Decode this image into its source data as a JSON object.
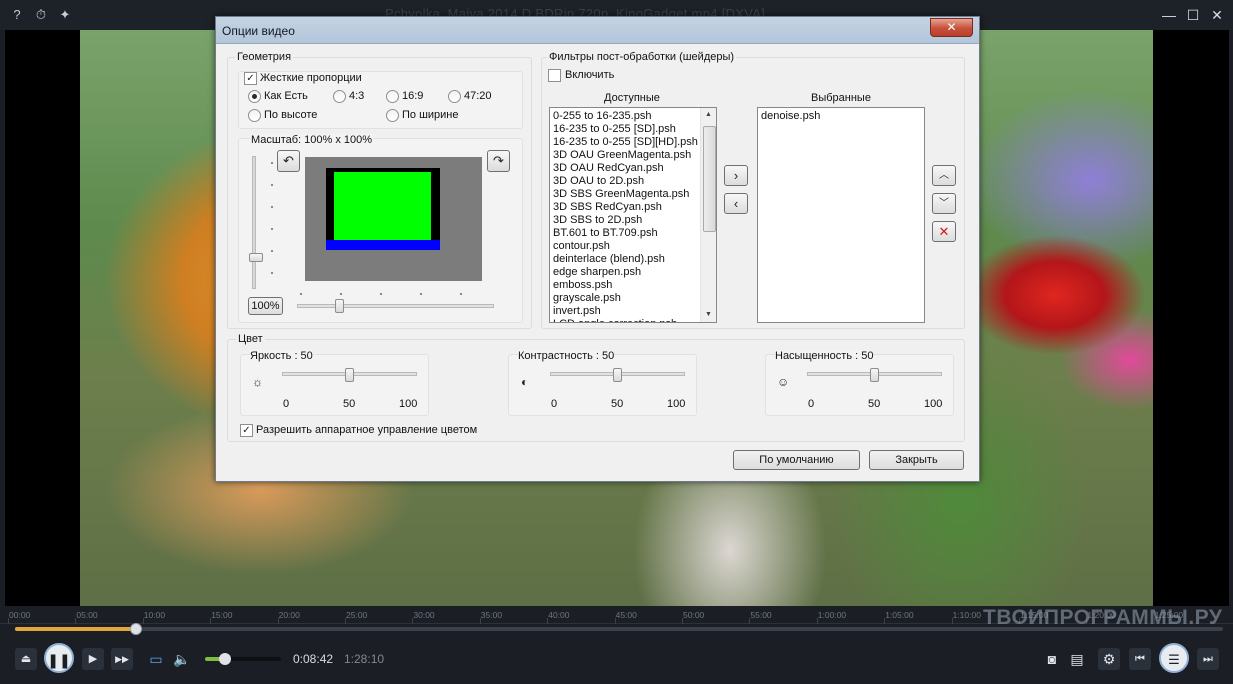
{
  "window": {
    "title": "Pchyolka_Maiya.2014.D.BDRip.720p_KinoGadget.mp4 [DXVA]",
    "controls": {
      "minimize": "—",
      "maximize": "☐",
      "close": "✕"
    }
  },
  "titlebar": {
    "help_icon": "?",
    "history_icon": "⏱",
    "pin_icon": "✦"
  },
  "dialog": {
    "title": "Опции видео",
    "close": "✕",
    "geometry": {
      "label": "Геометрия",
      "fixed_aspect_label": "Жесткие пропорции",
      "fixed_aspect_checked": true,
      "aspect_options": [
        {
          "label": "Как Есть",
          "selected": true
        },
        {
          "label": "4:3",
          "selected": false
        },
        {
          "label": "16:9",
          "selected": false
        },
        {
          "label": "47:20",
          "selected": false
        }
      ],
      "fit_options": [
        {
          "label": "По высоте",
          "selected": false
        },
        {
          "label": "По ширине",
          "selected": false
        }
      ],
      "scale_label": "Масштаб: 100% x 100%",
      "reset_label": "100%",
      "rotate_left": "↶",
      "rotate_right": "↷"
    },
    "filters": {
      "label": "Фильтры пост-обработки (шейдеры)",
      "enable_label": "Включить",
      "enable_checked": false,
      "available_header": "Доступные",
      "selected_header": "Выбранные",
      "available": [
        "0-255 to 16-235.psh",
        "16-235 to 0-255 [SD].psh",
        "16-235 to 0-255 [SD][HD].psh",
        "3D OAU GreenMagenta.psh",
        "3D OAU RedCyan.psh",
        "3D OAU to 2D.psh",
        "3D SBS GreenMagenta.psh",
        "3D SBS RedCyan.psh",
        "3D SBS to 2D.psh",
        "BT.601 to BT.709.psh",
        "contour.psh",
        "deinterlace (blend).psh",
        "edge sharpen.psh",
        "emboss.psh",
        "grayscale.psh",
        "invert.psh",
        "LCD angle correction.psh"
      ],
      "selected": [
        "denoise.psh"
      ],
      "add": "›",
      "remove": "‹",
      "up": "︿",
      "down": "﹀",
      "delete": "✕"
    },
    "color": {
      "label": "Цвет",
      "brightness": {
        "label": "Яркость : 50",
        "min": "0",
        "mid": "50",
        "max": "100",
        "value": 50,
        "icon": "☼"
      },
      "contrast": {
        "label": "Контрастность : 50",
        "min": "0",
        "mid": "50",
        "max": "100",
        "value": 50,
        "icon": "◐"
      },
      "saturation": {
        "label": "Насыщенность : 50",
        "min": "0",
        "mid": "50",
        "max": "100",
        "value": 50,
        "icon": "☺"
      },
      "hw_label": "Разрешить аппаратное управление цветом",
      "hw_checked": true
    },
    "buttons": {
      "default": "По умолчанию",
      "close": "Закрыть"
    }
  },
  "player": {
    "timeline_marks": [
      "00:00",
      "05:00",
      "10:00",
      "15:00",
      "20:00",
      "25:00",
      "30:00",
      "35:00",
      "40:00",
      "45:00",
      "50:00",
      "55:00",
      "1:00:00",
      "1:05:00",
      "1:10:00",
      "1:15:00",
      "1:20:00",
      "1:25:00"
    ],
    "progress": 0.1,
    "volume": 0.26,
    "time_current": "0:08:42",
    "time_total": "1:28:10",
    "watermark": "ТВОИПРОГРАММЫ.РУ",
    "icons": {
      "eject": "⏏",
      "play_pause": "❚❚",
      "step": "▶",
      "fast_forward": "▶▶",
      "subtitles": "▭",
      "volume": "🔈",
      "screenshot": "◙",
      "film": "▤",
      "settings": "⚙",
      "prev": "⏮",
      "playlist": "☰",
      "next": "⏭"
    },
    "accent_color": "#e2a73b"
  }
}
